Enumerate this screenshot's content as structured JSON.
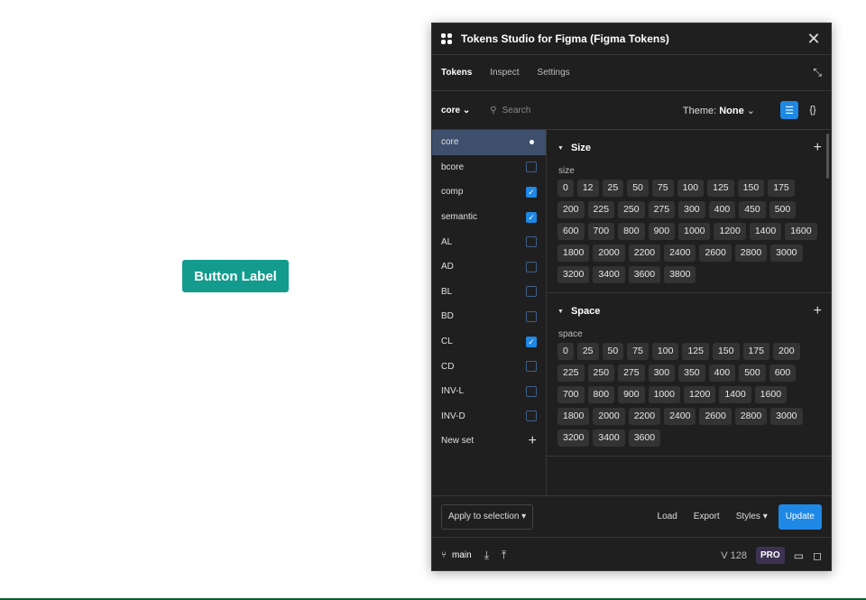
{
  "canvas": {
    "button_label": "Button Label"
  },
  "plugin": {
    "title": "Tokens Studio for Figma (Figma Tokens)",
    "tabs": [
      "Tokens",
      "Inspect",
      "Settings"
    ],
    "active_tab": "Tokens",
    "toolbar": {
      "token_set": "core",
      "search_placeholder": "Search",
      "theme_label": "Theme:",
      "theme_value": "None"
    },
    "sidebar": [
      {
        "label": "core",
        "state": "active"
      },
      {
        "label": "bcore",
        "state": "unchecked"
      },
      {
        "label": "comp",
        "state": "checked"
      },
      {
        "label": "semantic",
        "state": "checked"
      },
      {
        "label": "AL",
        "state": "unchecked"
      },
      {
        "label": "AD",
        "state": "unchecked"
      },
      {
        "label": "BL",
        "state": "unchecked"
      },
      {
        "label": "BD",
        "state": "unchecked"
      },
      {
        "label": "CL",
        "state": "checked"
      },
      {
        "label": "CD",
        "state": "unchecked"
      },
      {
        "label": "INV-L",
        "state": "unchecked"
      },
      {
        "label": "INV-D",
        "state": "unchecked"
      }
    ],
    "new_set_label": "New set",
    "sections": [
      {
        "title": "Size",
        "group": "size",
        "tokens": [
          "0",
          "12",
          "25",
          "50",
          "75",
          "100",
          "125",
          "150",
          "175",
          "200",
          "225",
          "250",
          "275",
          "300",
          "400",
          "450",
          "500",
          "600",
          "700",
          "800",
          "900",
          "1000",
          "1200",
          "1400",
          "1600",
          "1800",
          "2000",
          "2200",
          "2400",
          "2600",
          "2800",
          "3000",
          "3200",
          "3400",
          "3600",
          "3800"
        ]
      },
      {
        "title": "Space",
        "group": "space",
        "tokens": [
          "0",
          "25",
          "50",
          "75",
          "100",
          "125",
          "150",
          "175",
          "200",
          "225",
          "250",
          "275",
          "300",
          "350",
          "400",
          "500",
          "600",
          "700",
          "800",
          "900",
          "1000",
          "1200",
          "1400",
          "1600",
          "1800",
          "2000",
          "2200",
          "2400",
          "2600",
          "2800",
          "3000",
          "3200",
          "3400",
          "3600"
        ]
      }
    ],
    "footer": {
      "apply": "Apply to selection",
      "load": "Load",
      "export": "Export",
      "styles": "Styles",
      "update": "Update"
    },
    "status": {
      "branch": "main",
      "version": "V 128",
      "badge": "PRO"
    }
  }
}
